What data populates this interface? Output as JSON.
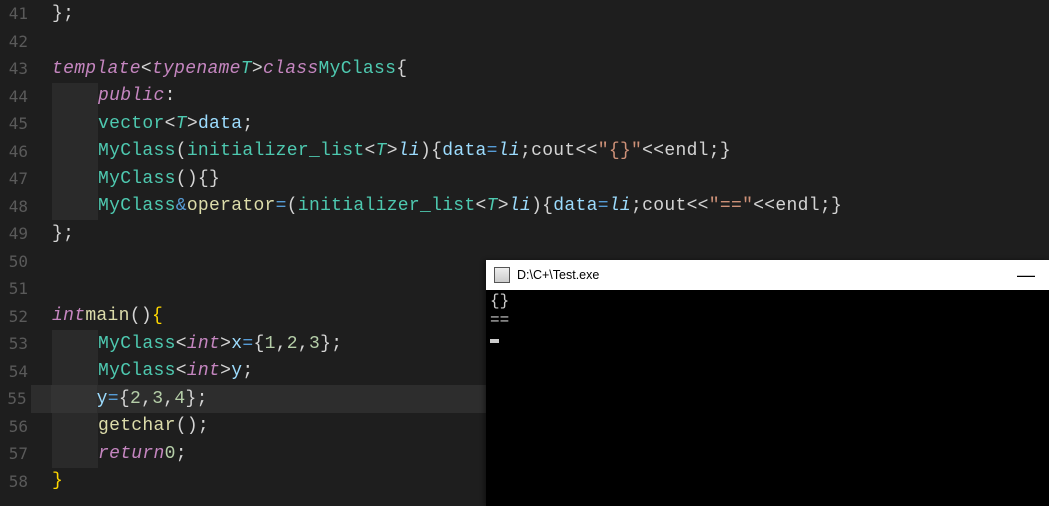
{
  "lines": [
    {
      "n": "41",
      "html": [
        "<span class='pn'>};</span>"
      ],
      "plain": "};"
    },
    {
      "n": "42",
      "html": [
        ""
      ]
    },
    {
      "n": "43",
      "html": [
        "<span class='kw'>template</span><span class='pn'>&lt;</span><span class='kw'>typename</span> <span class='tparam'>T</span><span class='pn'>&gt;</span> <span class='kw'>class</span> <span class='type'>MyClass</span><span class='pn'>{</span>"
      ]
    },
    {
      "n": "44",
      "indent": 1,
      "html": [
        "<span class='kw2'>public</span><span class='pn'>:</span>"
      ]
    },
    {
      "n": "45",
      "indent": 1,
      "html": [
        "<span class='type'>vector</span><span class='pn'>&lt;</span><span class='tparam'>T</span><span class='pn'>&gt;</span> <span class='id'>data</span><span class='pn'>;</span>"
      ]
    },
    {
      "n": "46",
      "indent": 1,
      "html": [
        "<span class='type'>MyClass</span><span class='pn'>(</span><span class='type'>initializer_list</span><span class='pn'>&lt;</span><span class='tparam'>T</span><span class='pn'>&gt;</span> <span class='param'>li</span><span class='pn'>){</span><span class='id'>data</span><span class='op2'>=</span><span class='param'>li</span><span class='pn'>;</span><span class='strm'>cout</span><span class='op'>&lt;&lt;</span><span class='str'>\"{}\"</span><span class='op'>&lt;&lt;</span><span class='strm'>endl</span><span class='pn'>;}</span>"
      ]
    },
    {
      "n": "47",
      "indent": 1,
      "html": [
        "<span class='type'>MyClass</span><span class='pn'>(){}</span>"
      ]
    },
    {
      "n": "48",
      "indent": 1,
      "html": [
        "<span class='type'>MyClass</span><span class='op2'>&amp;</span> <span class='fn'>operator</span><span class='op2'>=</span><span class='pn'>(</span><span class='type'>initializer_list</span><span class='pn'>&lt;</span><span class='tparam'>T</span><span class='pn'>&gt;</span> <span class='param'>li</span><span class='pn'>){</span><span class='id'>data</span><span class='op2'>=</span><span class='param'>li</span><span class='pn'>;</span><span class='strm'>cout</span><span class='op'>&lt;&lt;</span><span class='str'>\"==\"</span><span class='op'>&lt;&lt;</span><span class='strm'>endl</span><span class='pn'>;}</span>"
      ]
    },
    {
      "n": "49",
      "html": [
        "<span class='pn'>};</span>"
      ]
    },
    {
      "n": "50",
      "html": [
        ""
      ]
    },
    {
      "n": "51",
      "html": [
        ""
      ]
    },
    {
      "n": "52",
      "html": [
        "<span class='kw'>int</span> <span class='fn'>main</span><span class='pn'>()</span> <span class='pnb'>{</span>"
      ]
    },
    {
      "n": "53",
      "indent": 1,
      "html": [
        "<span class='type'>MyClass</span><span class='pn'>&lt;</span><span class='kw'>int</span><span class='pn'>&gt;</span> <span class='id'>x</span><span class='op2'>=</span><span class='pn'>{</span><span class='num'>1</span><span class='pn'>,</span><span class='num'>2</span><span class='pn'>,</span><span class='num'>3</span><span class='pn'>};</span>"
      ]
    },
    {
      "n": "54",
      "indent": 1,
      "html": [
        "<span class='type'>MyClass</span><span class='pn'>&lt;</span><span class='kw'>int</span><span class='pn'>&gt;</span> <span class='id'>y</span><span class='pn'>;</span>"
      ]
    },
    {
      "n": "55",
      "indent": 1,
      "hl": true,
      "html": [
        "<span class='id'>y</span><span class='op2'>=</span><span class='pn'>{</span><span class='num'>2</span><span class='pn'>,</span><span class='num'>3</span><span class='pn'>,</span><span class='num'>4</span><span class='pn'>};</span>"
      ]
    },
    {
      "n": "56",
      "indent": 1,
      "html": [
        "<span class='fn'>getchar</span><span class='pn'>();</span>"
      ]
    },
    {
      "n": "57",
      "indent": 1,
      "html": [
        "<span class='kw'>return</span> <span class='num'>0</span><span class='pn'>;</span>"
      ]
    },
    {
      "n": "58",
      "html": [
        "<span class='pnb'>}</span>"
      ]
    }
  ],
  "console": {
    "title": "D:\\C+\\Test.exe",
    "out": [
      "{}",
      "=="
    ],
    "minimize": "—"
  }
}
